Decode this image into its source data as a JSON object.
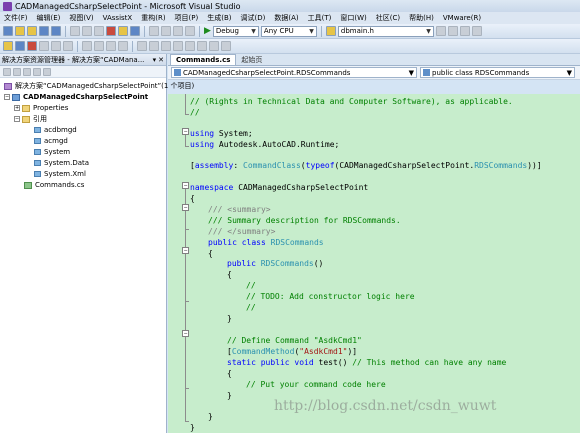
{
  "window": {
    "title": "CADManagedCsharpSelectPoint - Microsoft Visual Studio"
  },
  "menu": [
    "文件(F)",
    "编辑(E)",
    "视图(V)",
    "VAssistX",
    "重构(R)",
    "项目(P)",
    "生成(B)",
    "调试(D)",
    "数据(A)",
    "工具(T)",
    "窗口(W)",
    "社区(C)",
    "帮助(H)",
    "VMware(R)"
  ],
  "toolbar": {
    "config": "Debug",
    "platform": "Any CPU",
    "find_value": "dbmain.h"
  },
  "solution_explorer": {
    "header": "解决方案资源管理器 - 解决方案“CADMana...",
    "items": [
      {
        "label": "解决方案“CADManagedCsharpSelectPoint”(1 个项目)"
      },
      {
        "label": "CADManagedCsharpSelectPoint"
      },
      {
        "label": "Properties"
      },
      {
        "label": "引用"
      },
      {
        "label": "acdbmgd"
      },
      {
        "label": "acmgd"
      },
      {
        "label": "System"
      },
      {
        "label": "System.Data"
      },
      {
        "label": "System.Xml"
      },
      {
        "label": "Commands.cs"
      }
    ]
  },
  "editor": {
    "tabs": [
      {
        "label": "Commands.cs"
      },
      {
        "label": "起始页"
      }
    ],
    "nav_left": "CADManagedCsharpSelectPoint.RDSCommands",
    "nav_right": "public class RDSCommands",
    "lines": [
      "// (Rights in Technical Data and Computer Software), as applicable.",
      "//",
      "using System;",
      "using Autodesk.AutoCAD.Runtime;",
      "[assembly: CommandClass(typeof(CADManagedCsharpSelectPoint.RDSCommands))]",
      "namespace CADManagedCsharpSelectPoint",
      "{",
      "/// <summary>",
      "/// Summary description for RDSCommands.",
      "/// </summary>",
      "public class RDSCommands",
      "{",
      "public RDSCommands()",
      "{",
      "//",
      "// TODO: Add constructor logic here",
      "//",
      "}",
      "// Define Command \"AsdkCmd1\"",
      "[CommandMethod(\"AsdkCmd1\")]",
      "static public void test() // This method can have any name",
      "{",
      "// Put your command code here",
      "}",
      "}",
      "}"
    ]
  },
  "watermark": "http://blog.csdn.net/csdn_wuwt"
}
